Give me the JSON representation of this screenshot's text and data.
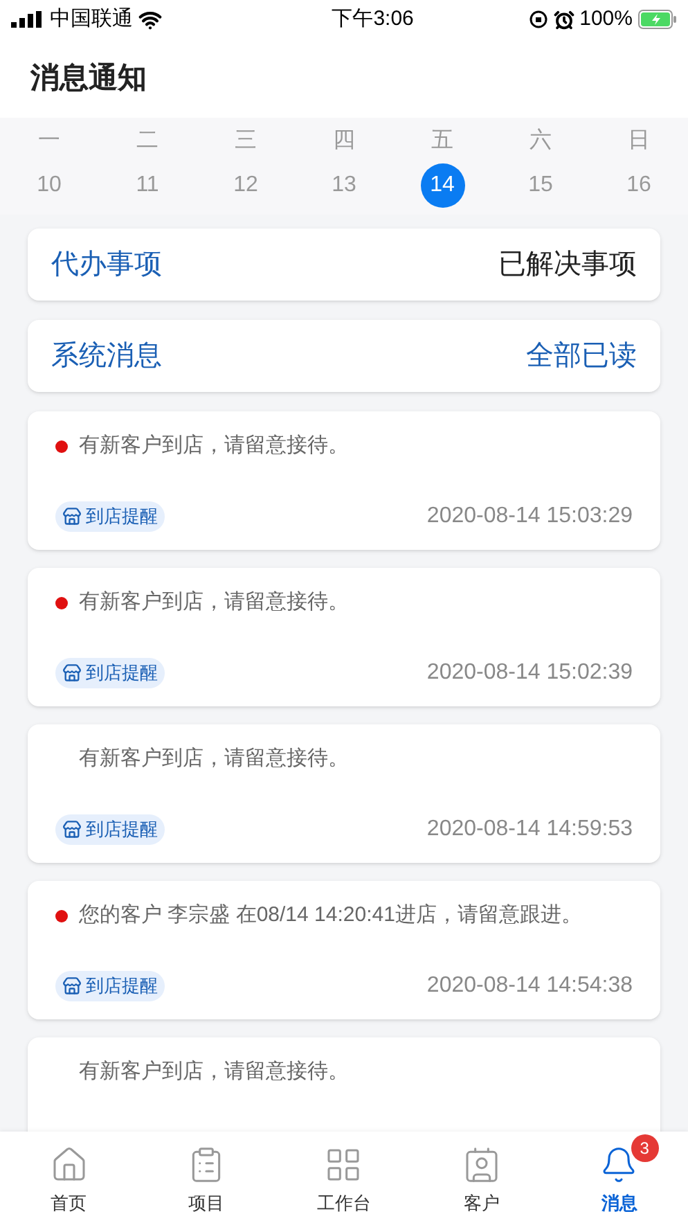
{
  "status_bar": {
    "carrier": "中国联通",
    "time": "下午3:06",
    "battery": "100%"
  },
  "title": "消息通知",
  "week": [
    {
      "weekday": "一",
      "date": "10",
      "selected": false
    },
    {
      "weekday": "二",
      "date": "11",
      "selected": false
    },
    {
      "weekday": "三",
      "date": "12",
      "selected": false
    },
    {
      "weekday": "四",
      "date": "13",
      "selected": false
    },
    {
      "weekday": "五",
      "date": "14",
      "selected": true
    },
    {
      "weekday": "六",
      "date": "15",
      "selected": false
    },
    {
      "weekday": "日",
      "date": "16",
      "selected": false
    }
  ],
  "sections": [
    {
      "left": "代办事项",
      "right": "已解决事项",
      "kind": "plain"
    },
    {
      "left": "系统消息",
      "right": "全部已读",
      "kind": "link"
    }
  ],
  "messages": [
    {
      "text": "有新客户到店，请留意接待。",
      "unread": true,
      "tag": "到店提醒",
      "time": "2020-08-14 15:03:29"
    },
    {
      "text": "有新客户到店，请留意接待。",
      "unread": true,
      "tag": "到店提醒",
      "time": "2020-08-14 15:02:39"
    },
    {
      "text": "有新客户到店，请留意接待。",
      "unread": false,
      "tag": "到店提醒",
      "time": "2020-08-14 14:59:53"
    },
    {
      "text": "您的客户 李宗盛 在08/14 14:20:41进店，请留意跟进。",
      "unread": true,
      "tag": "到店提醒",
      "time": "2020-08-14 14:54:38"
    },
    {
      "text": "有新客户到店，请留意接待。",
      "unread": false
    }
  ],
  "tab_bar": [
    {
      "label": "首页",
      "kind": "home",
      "selected": false
    },
    {
      "label": "项目",
      "kind": "project",
      "selected": false
    },
    {
      "label": "工作台",
      "kind": "grid",
      "selected": false
    },
    {
      "label": "客户",
      "kind": "contact",
      "selected": false
    },
    {
      "label": "消息",
      "kind": "bell",
      "selected": true,
      "badge": "3"
    }
  ]
}
